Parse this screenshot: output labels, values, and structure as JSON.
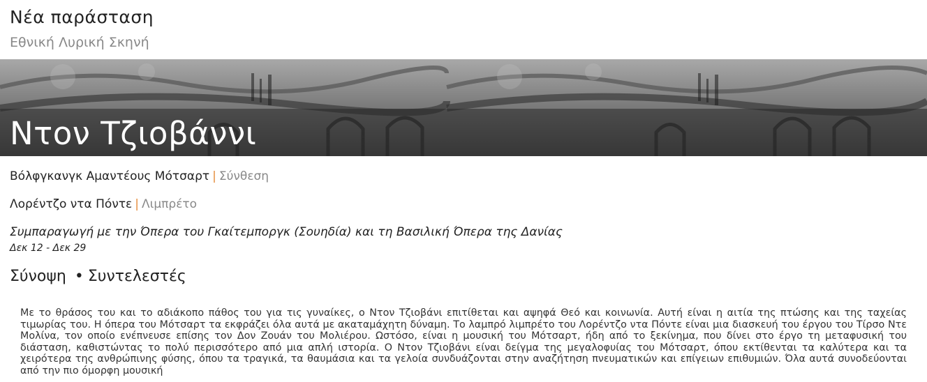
{
  "header": {
    "title": "Νέα παράσταση",
    "subtitle": "Εθνική Λυρική Σκηνή"
  },
  "hero": {
    "title": "Ντον Τζιοβάννι"
  },
  "credits": [
    {
      "name": "Βόλφγκανγκ Αμαντέους Μότσαρτ",
      "separator": "|",
      "role": "Σύνθεση"
    },
    {
      "name": "Λορέντζο ντα Πόντε",
      "separator": "|",
      "role": "Λιμπρέτο"
    }
  ],
  "coproduction": "Συμπαραγωγή με την Όπερα του Γκαίτεμποργκ (Σουηδία) και τη Βασιλική Όπερα της Δανίας",
  "dates": "Δεκ 12 - Δεκ 29",
  "tabs": {
    "synopsis": "Σύνοψη",
    "bullet": "•",
    "cast": "Συντελεστές"
  },
  "synopsis": "Με το θράσος του και το αδιάκοπο πάθος του για τις γυναίκες, ο Ντον Τζιοβάνι επιτίθεται και αψηφά Θεό και κοινωνία. Αυτή είναι η αιτία της πτώσης και της ταχείας τιμωρίας του. Η όπερα του Μότσαρτ τα εκφράζει όλα αυτά με ακαταμάχητη δύναμη. Το λαμπρό λιμπρέτο του Λορέντζο ντα Πόντε είναι μια διασκευή του έργου του Τίρσο Ντε Μολίνα, τον οποίο ενέπνευσε επίσης τον Δον Ζουάν του Μολιέρου. Ωστόσο, είναι η μουσική του Μότσαρτ, ήδη από το ξεκίνημα, που δίνει στο έργο τη μεταφυσική του διάσταση, καθιστώντας το πολύ περισσότερο από μια απλή ιστορία. Ο Ντον Τζιοβάνι είναι δείγμα της μεγαλοφυίας του Μότσαρτ, όπου εκτίθενται τα καλύτερα και τα χειρότερα της ανθρώπινης φύσης, όπου τα τραγικά, τα θαυμάσια και τα γελοία συνδυάζονται στην αναζήτηση πνευματικών και επίγειων επιθυμιών. Όλα αυτά συνοδεύονται από την πιο όμορφη μουσική"
}
